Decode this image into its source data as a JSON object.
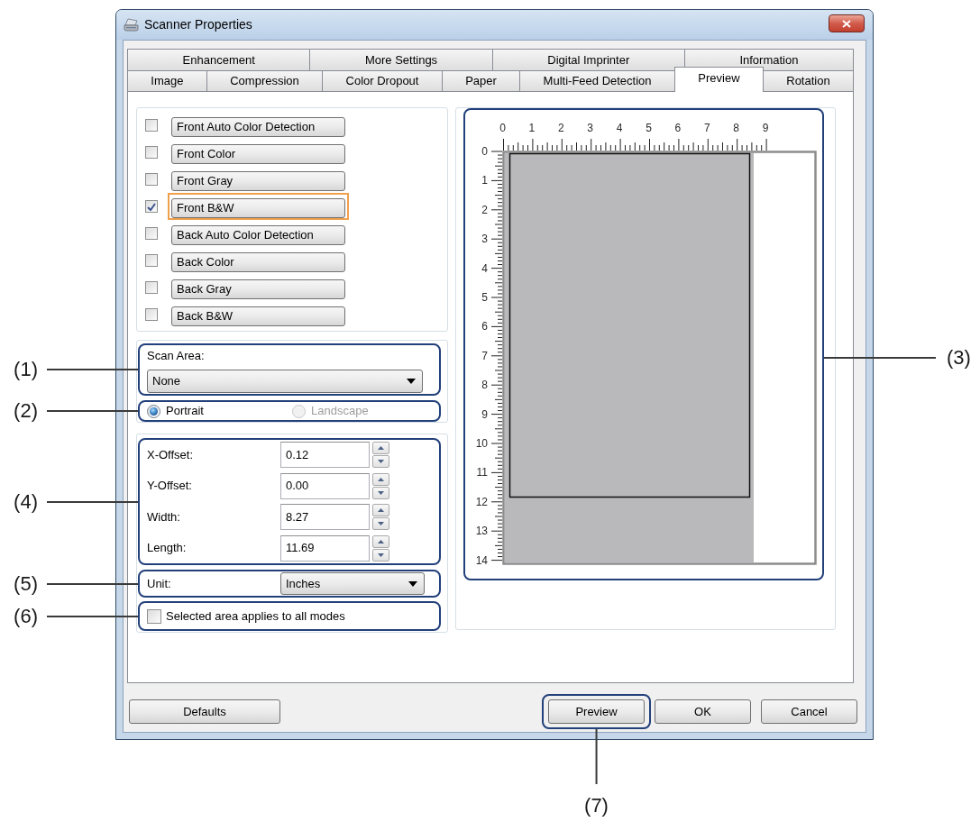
{
  "window": {
    "title": "Scanner Properties"
  },
  "tab_rows": [
    {
      "tabs": [
        {
          "label": "Enhancement",
          "selected": false
        },
        {
          "label": "More Settings",
          "selected": false
        },
        {
          "label": "Digital Imprinter",
          "selected": false
        },
        {
          "label": "Information",
          "selected": false
        }
      ]
    },
    {
      "tabs": [
        {
          "label": "Image",
          "selected": false
        },
        {
          "label": "Compression",
          "selected": false
        },
        {
          "label": "Color Dropout",
          "selected": false
        },
        {
          "label": "Paper",
          "selected": false
        },
        {
          "label": "Multi-Feed Detection",
          "selected": false
        },
        {
          "label": "Preview",
          "selected": true
        },
        {
          "label": "Rotation",
          "selected": false
        }
      ]
    }
  ],
  "image_modes": [
    {
      "label": "Front Auto Color Detection",
      "checked": false,
      "focused": false
    },
    {
      "label": "Front Color",
      "checked": false,
      "focused": false
    },
    {
      "label": "Front Gray",
      "checked": false,
      "focused": false
    },
    {
      "label": "Front B&W",
      "checked": true,
      "focused": true
    },
    {
      "label": "Back Auto Color Detection",
      "checked": false,
      "focused": false
    },
    {
      "label": "Back Color",
      "checked": false,
      "focused": false
    },
    {
      "label": "Back Gray",
      "checked": false,
      "focused": false
    },
    {
      "label": "Back B&W",
      "checked": false,
      "focused": false
    }
  ],
  "scan_area": {
    "callout": "(1)",
    "label": "Scan Area:",
    "value": "None"
  },
  "orientation": {
    "callout": "(2)",
    "options": [
      {
        "label": "Portrait",
        "selected": true,
        "disabled": false
      },
      {
        "label": "Landscape",
        "selected": false,
        "disabled": true
      }
    ]
  },
  "dimensions": {
    "callout": "(4)",
    "fields": [
      {
        "label": "X-Offset:",
        "value": "0.12"
      },
      {
        "label": "Y-Offset:",
        "value": "0.00"
      },
      {
        "label": "Width:",
        "value": "8.27"
      },
      {
        "label": "Length:",
        "value": "11.69"
      }
    ]
  },
  "unit": {
    "callout": "(5)",
    "label": "Unit:",
    "value": "Inches"
  },
  "apply_to_all": {
    "callout": "(6)",
    "label": "Selected area applies to all modes",
    "checked": false
  },
  "preview": {
    "callout": "(3)",
    "x_ruler": [
      "0",
      "1",
      "2",
      "3",
      "4",
      "5",
      "6",
      "7",
      "8",
      "9"
    ],
    "y_ruler": [
      "0",
      "1",
      "2",
      "3",
      "4",
      "5",
      "6",
      "7",
      "8",
      "9",
      "10",
      "11",
      "12",
      "13",
      "14"
    ]
  },
  "footer": {
    "left_buttons": [
      {
        "label": "Defaults"
      }
    ],
    "right_buttons": [
      {
        "label": "Preview",
        "callout": "(7)"
      },
      {
        "label": "OK"
      },
      {
        "label": "Cancel"
      }
    ]
  }
}
